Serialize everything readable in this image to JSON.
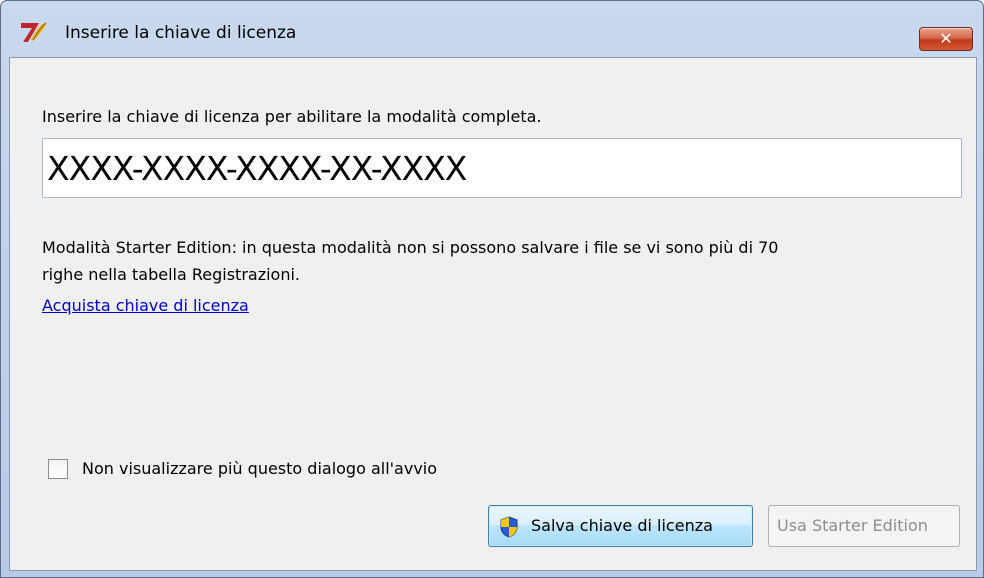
{
  "window": {
    "title": "Inserire la chiave di licenza",
    "close_symbol": "✕"
  },
  "dialog": {
    "instruction": "Inserire la chiave di licenza per abilitare la modalità completa.",
    "key_value": "XXXX-XXXX-XXXX-XX-XXXX",
    "note_line1": "Modalità Starter Edition: in questa modalità non si possono salvare i file se vi sono più di 70",
    "note_line2": "righe nella tabella Registrazioni.",
    "buy_link": "Acquista chiave di licenza",
    "checkbox_label": "Non visualizzare più questo dialogo all'avvio",
    "checkbox_checked": false,
    "save_button": "Salva chiave di licenza",
    "starter_button": "Usa Starter Edition"
  },
  "icons": {
    "app": "app-logo-icon",
    "shield": "uac-shield-icon",
    "close": "close-icon"
  },
  "colors": {
    "link": "#0000cc",
    "close_button": "#c03a1c",
    "title_bar": "#bcd0ea",
    "disabled_text": "#8d8d8d"
  }
}
